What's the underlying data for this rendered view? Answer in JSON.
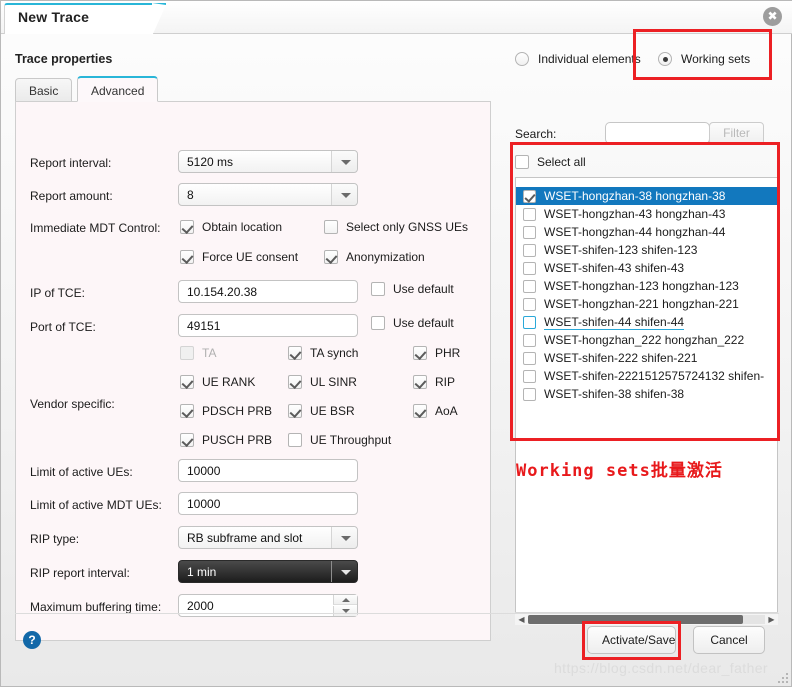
{
  "window": {
    "title": "New Trace",
    "close_icon": "close-icon"
  },
  "left": {
    "section_title": "Trace properties",
    "tabs": [
      {
        "label": "Basic",
        "active": false
      },
      {
        "label": "Advanced",
        "active": true
      }
    ],
    "fields": {
      "report_interval": {
        "label": "Report interval:",
        "value": "5120 ms",
        "type": "combo"
      },
      "report_amount": {
        "label": "Report amount:",
        "value": "8",
        "type": "combo"
      },
      "immediate_mdt": {
        "label": "Immediate MDT Control:"
      },
      "ip_of_tce": {
        "label": "IP of TCE:",
        "value": "10.154.20.38"
      },
      "port_of_tce": {
        "label": "Port of TCE:",
        "value": "49151"
      },
      "vendor_specific": {
        "label": "Vendor specific:"
      },
      "limit_active_ues": {
        "label": "Limit of active UEs:",
        "value": "10000"
      },
      "limit_active_mdt_ues": {
        "label": "Limit of active MDT UEs:",
        "value": "10000"
      },
      "rip_type": {
        "label": "RIP type:",
        "value": "RB subframe and slot",
        "type": "combo"
      },
      "rip_report_interval": {
        "label": "RIP report interval:",
        "value": "1 min",
        "type": "combo"
      },
      "max_buffering_time": {
        "label": "Maximum buffering time:",
        "value": "2000"
      }
    },
    "mdt_checkboxes": [
      {
        "label": "Obtain location",
        "checked": true,
        "enabled": true
      },
      {
        "label": "Select only GNSS UEs",
        "checked": false,
        "enabled": true
      },
      {
        "label": "Force UE consent",
        "checked": true,
        "enabled": true
      },
      {
        "label": "Anonymization",
        "checked": true,
        "enabled": true
      }
    ],
    "use_default_ip": {
      "label": "Use default",
      "checked": false
    },
    "use_default_port": {
      "label": "Use default",
      "checked": false
    },
    "vendor_checkboxes": [
      {
        "label": "TA",
        "checked": false,
        "enabled": false
      },
      {
        "label": "TA synch",
        "checked": true,
        "enabled": true
      },
      {
        "label": "PHR",
        "checked": true,
        "enabled": true
      },
      {
        "label": "UE RANK",
        "checked": true,
        "enabled": true
      },
      {
        "label": "UL SINR",
        "checked": true,
        "enabled": true
      },
      {
        "label": "RIP",
        "checked": true,
        "enabled": true
      },
      {
        "label": "PDSCH PRB",
        "checked": true,
        "enabled": true
      },
      {
        "label": "UE BSR",
        "checked": true,
        "enabled": true
      },
      {
        "label": "AoA",
        "checked": true,
        "enabled": true
      },
      {
        "label": "PUSCH PRB",
        "checked": true,
        "enabled": true
      },
      {
        "label": "UE Throughput",
        "checked": false,
        "enabled": true
      }
    ]
  },
  "right": {
    "radios": [
      {
        "label": "Individual elements",
        "selected": false
      },
      {
        "label": "Working sets",
        "selected": true
      }
    ],
    "search_label": "Search:",
    "search_value": "",
    "search_placeholder": "",
    "filter_label": "Filter",
    "select_all": {
      "label": "Select all",
      "checked": false
    },
    "list_items": [
      {
        "label": "WSET-hongzhan-38 hongzhan-38",
        "checked": true,
        "selected": true,
        "focused": false
      },
      {
        "label": "WSET-hongzhan-43 hongzhan-43",
        "checked": false,
        "selected": false,
        "focused": false
      },
      {
        "label": "WSET-hongzhan-44 hongzhan-44",
        "checked": false,
        "selected": false,
        "focused": false
      },
      {
        "label": "WSET-shifen-123 shifen-123",
        "checked": false,
        "selected": false,
        "focused": false
      },
      {
        "label": "WSET-shifen-43 shifen-43",
        "checked": false,
        "selected": false,
        "focused": false
      },
      {
        "label": "WSET-hongzhan-123 hongzhan-123",
        "checked": false,
        "selected": false,
        "focused": false
      },
      {
        "label": "WSET-hongzhan-221 hongzhan-221",
        "checked": false,
        "selected": false,
        "focused": false
      },
      {
        "label": "WSET-shifen-44 shifen-44",
        "checked": false,
        "selected": false,
        "focused": true
      },
      {
        "label": "WSET-hongzhan_222 hongzhan_222",
        "checked": false,
        "selected": false,
        "focused": false
      },
      {
        "label": "WSET-shifen-222 shifen-221",
        "checked": false,
        "selected": false,
        "focused": false
      },
      {
        "label": "WSET-shifen-2221512575724132 shifen-",
        "checked": false,
        "selected": false,
        "focused": false
      },
      {
        "label": "WSET-shifen-38 shifen-38",
        "checked": false,
        "selected": false,
        "focused": false
      }
    ],
    "scroll_left_icon": "◀",
    "scroll_right_icon": "▶"
  },
  "annotation": {
    "text": "Working sets批量激活",
    "color": "#e8191b"
  },
  "footer": {
    "help_icon_label": "?",
    "activate_label": "Activate/Save",
    "cancel_label": "Cancel",
    "watermark": "https://blog.csdn.net/dear_father"
  }
}
